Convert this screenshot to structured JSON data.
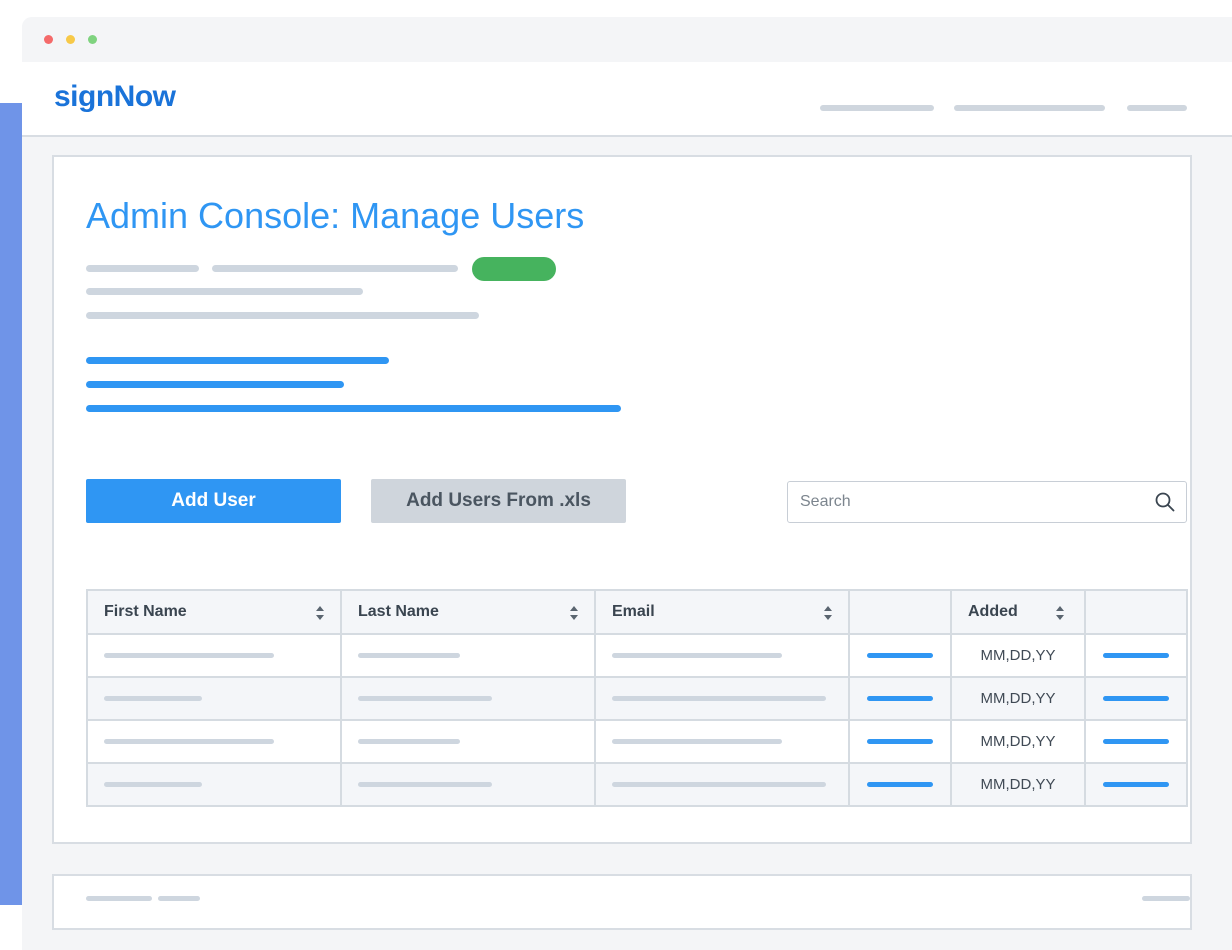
{
  "window": {
    "controls": [
      "close",
      "minimize",
      "maximize"
    ]
  },
  "header": {
    "logo": "signNow"
  },
  "page": {
    "title": "Admin Console: Manage Users"
  },
  "toolbar": {
    "add_user_label": "Add User",
    "add_users_xls_label": "Add Users From .xls",
    "search_placeholder": "Search"
  },
  "table": {
    "columns": [
      {
        "label": "First Name",
        "sortable": true
      },
      {
        "label": "Last Name",
        "sortable": true
      },
      {
        "label": "Email",
        "sortable": true
      },
      {
        "label": "",
        "sortable": false
      },
      {
        "label": "Added",
        "sortable": true
      },
      {
        "label": "",
        "sortable": false
      }
    ],
    "rows": [
      {
        "added": "MM,DD,YY"
      },
      {
        "added": "MM,DD,YY"
      },
      {
        "added": "MM,DD,YY"
      },
      {
        "added": "MM,DD,YY"
      }
    ]
  },
  "colors": {
    "brand_blue": "#1a73d9",
    "title_blue": "#2f96f3",
    "primary_button": "#2f96f3",
    "secondary_button": "#cfd5dc",
    "status_green": "#46b35e",
    "dot_red": "#f46a6a",
    "dot_yellow": "#f7c948",
    "dot_green": "#7fd37f"
  },
  "icons": {
    "search": "search-icon",
    "sort": "sort-icon"
  }
}
